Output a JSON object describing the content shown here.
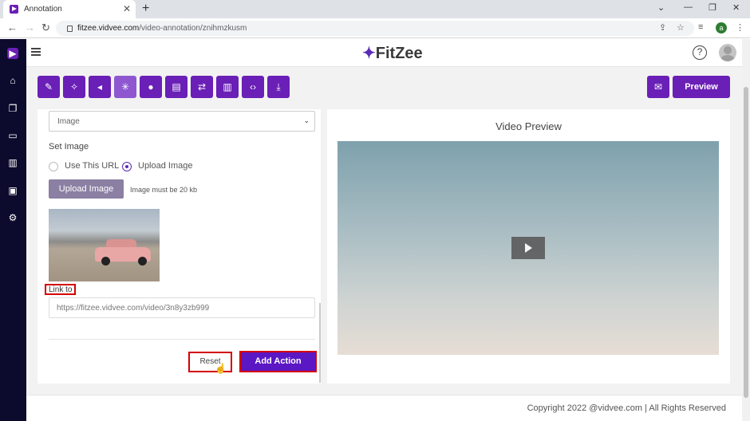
{
  "browser": {
    "tab_title": "Annotation",
    "url_host": "fitzee.vidvee.com",
    "url_path": "/video-annotation/znihmzkusm",
    "profile_initial": "a"
  },
  "header": {
    "logo_text": "FitZee"
  },
  "toolbar": {
    "preview_label": "Preview"
  },
  "form": {
    "type_select_value": "Image",
    "set_image_label": "Set Image",
    "radio_url_label": "Use This URL",
    "radio_upload_label": "Upload Image",
    "upload_button_label": "Upload Image",
    "upload_hint": "Image must be 20 kb",
    "link_to_label": "Link to",
    "link_url_value": "https://fitzee.vidvee.com/video/3n8y3zb999",
    "reset_label": "Reset",
    "add_action_label": "Add Action"
  },
  "preview": {
    "title": "Video Preview"
  },
  "footer": {
    "copyright": "Copyright 2022 @vidvee.com | All Rights Reserved"
  },
  "colors": {
    "brand_purple": "#6a1fb6",
    "sidebar_bg": "#0c0b2e",
    "highlight_red": "#d40000"
  }
}
